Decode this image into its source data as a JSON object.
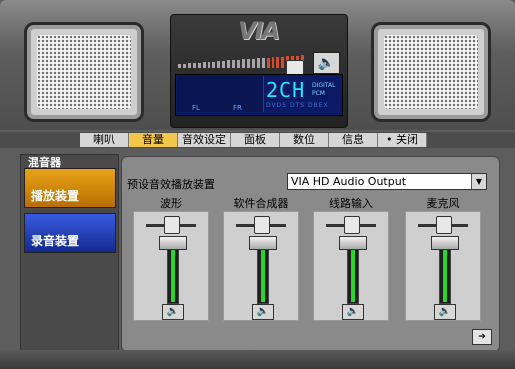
{
  "header": {
    "logo_text": "VIA",
    "lcd": {
      "left_label": "FL",
      "right_label": "FR",
      "digits": "2CH",
      "badge_top": "DIGITAL",
      "badge_bottom": "PCM",
      "sub_text": "DVD5  DTS  DBEX"
    }
  },
  "tabs": [
    {
      "label": "喇叭",
      "active": false
    },
    {
      "label": "音量",
      "active": true
    },
    {
      "label": "音效设定",
      "active": false
    },
    {
      "label": "面板",
      "active": false
    },
    {
      "label": "数位",
      "active": false
    },
    {
      "label": "信息",
      "active": false
    },
    {
      "label": "• 关闭",
      "active": false
    }
  ],
  "sidebar": {
    "title": "混音器",
    "items": [
      {
        "label": "播放装置",
        "selected": true
      },
      {
        "label": "录音装置",
        "selected": false
      }
    ]
  },
  "main": {
    "device_label": "预设音效播放装置",
    "device_value": "VIA HD Audio Output",
    "channels": [
      {
        "name": "波形",
        "volume": 0.95
      },
      {
        "name": "软件合成器",
        "volume": 0.95
      },
      {
        "name": "线路输入",
        "volume": 0.95
      },
      {
        "name": "麦克风",
        "volume": 0.95
      }
    ]
  },
  "icons": {
    "speaker": "speaker-icon",
    "next": "arrow-right-icon"
  },
  "colors": {
    "accent": "#f2c64a",
    "playback": "#e8a318",
    "record": "#2f4fd6",
    "lcd": "#21e8ff",
    "volume_fill": "#2bd62b"
  }
}
